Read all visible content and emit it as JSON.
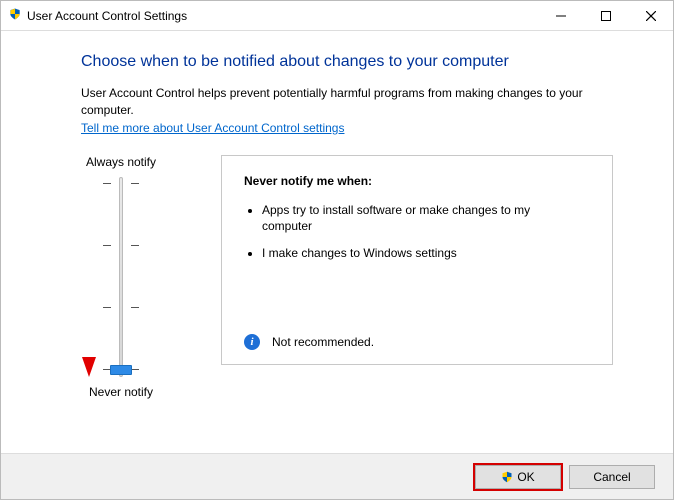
{
  "window": {
    "title": "User Account Control Settings"
  },
  "header": {
    "heading": "Choose when to be notified about changes to your computer",
    "description": "User Account Control helps prevent potentially harmful programs from making changes to your computer.",
    "link": "Tell me more about User Account Control settings"
  },
  "slider": {
    "top_label": "Always notify",
    "bottom_label": "Never notify",
    "levels": 4,
    "current_level": 0
  },
  "info_box": {
    "title": "Never notify me when:",
    "bullets": [
      "Apps try to install software or make changes to my computer",
      "I make changes to Windows settings"
    ],
    "footer": "Not recommended."
  },
  "buttons": {
    "ok": "OK",
    "cancel": "Cancel"
  }
}
